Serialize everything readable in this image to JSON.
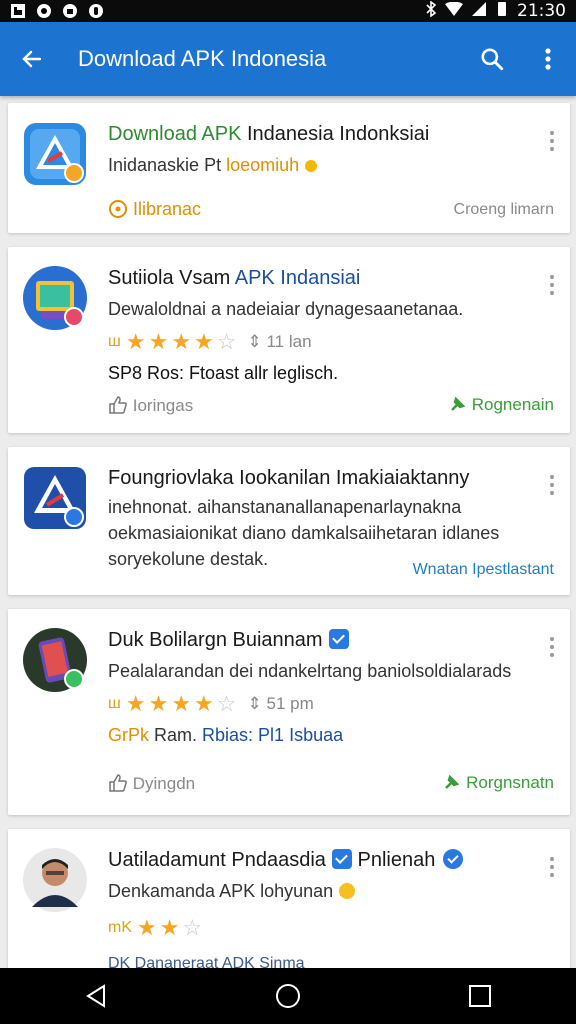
{
  "status_bar": {
    "time": "21:30"
  },
  "app_bar": {
    "title": "Download APK Indonesia",
    "back_icon": "arrow-left-icon",
    "search_icon": "search-icon",
    "menu_icon": "more-vert-icon"
  },
  "colors": {
    "primary": "#1c74d0",
    "green": "#2e8b2e",
    "star": "#f5a623",
    "link": "#1e7ec8"
  },
  "cards": [
    {
      "title_green": "Download APK",
      "title_rest": " Indanesia  Indonksiai",
      "subtitle_text": "Inidanaskie ",
      "subtitle_mid": "Pt ",
      "subtitle_accent": "loeomiuh",
      "label_left": "Ilibranac",
      "label_right": "Croeng limarn"
    },
    {
      "title_text": "Sutiiola Vsam ",
      "title_accent": "APK Indansiai",
      "description": "Dewaloldnai a nadeiaiar dynagesaanetanaa.",
      "stars_prefix": "ш",
      "rating": 3.5,
      "count": "11 lan",
      "meta_text": "SP8 Ros: Ftoast allr leglisch.",
      "action_left": "Ioringas",
      "action_right": "Rognenain"
    },
    {
      "title_text": "Foungriovlaka Iookanilan Imakiaiaktanny",
      "desc_line1": "inehnonat. aihanstananallanapenarlaynakna",
      "desc_line2": "oekmasiaionikat diano damkalsaiihetaran idlanes",
      "desc_line3": "soryekolune destak.",
      "link_text": "Wnatan Ipestlastant"
    },
    {
      "title_text": "Duk Bolilargn Buiannam",
      "description": "Pealalarandan dei ndankelrtang baniolsoldialarads",
      "stars_prefix": "ш",
      "rating": 3.5,
      "count": "51 pm",
      "meta_accent": "GrPk",
      "meta_text": " Ram. ",
      "meta_blue": "Rbias: Pl1 Isbuaa",
      "action_left": "Dyingdn",
      "action_right": "Rorgnsnatn"
    },
    {
      "title_text": "Uatiladamunt Pndaasdia",
      "title_extra": "Pnlienah",
      "description": "Denkamanda APK lohyunan",
      "stars_prefix": "mK",
      "rating": 2,
      "partial_text": "DK Dananeraat ADK Sinma"
    }
  ]
}
